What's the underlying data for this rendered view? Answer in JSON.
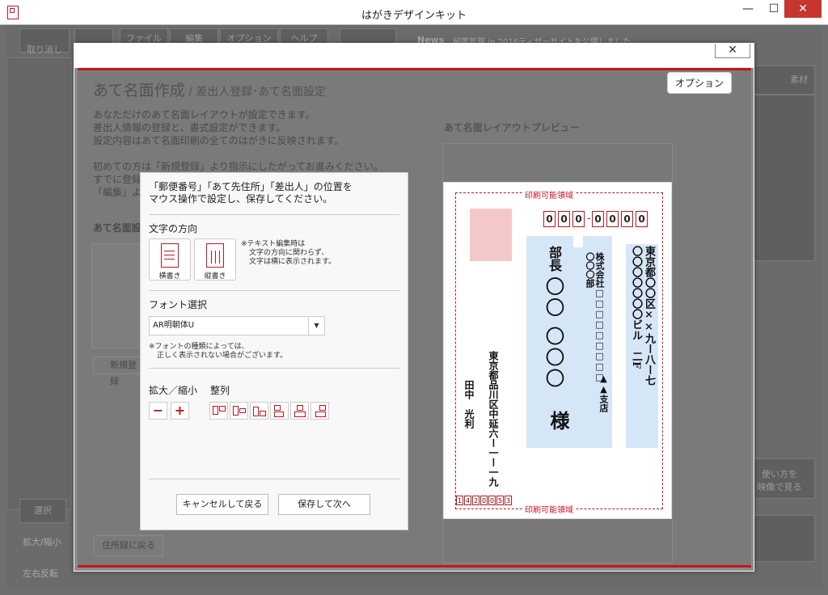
{
  "window": {
    "title": "はがきデザインキット",
    "minimize": "—",
    "maximize": "☐",
    "close": "✕"
  },
  "bg": {
    "undo": "取り消し",
    "menu": [
      "ファイル",
      "編集",
      "オプション",
      "ヘルプ"
    ],
    "news_label": "News",
    "news_text": "秘匿年賀.jp 2016ティザーサイトを公開しました。",
    "material": "素材",
    "select_tool": "選択",
    "zoom": "拡大/縮小",
    "flip": "左右反転",
    "how_to_1": "使い方を",
    "how_to_2": "映像で見る"
  },
  "modal": {
    "close": "✕",
    "heading": "あて名面作成",
    "subheading": " / 差出人登録･あて名面設定",
    "option_button": "オプション",
    "desc": [
      "あなただけのあて名面レイアウトが設定できます。",
      "差出人情報の登録と、書式設定ができます。",
      "設定内容はあて名面印刷の全てのはがきに反映されます。"
    ],
    "desc2": [
      "初めての方は「新規登録」より指示にしたがってお進みください。",
      "すでに登録",
      "「編集」より"
    ],
    "atena_label": "あて名面設",
    "new_reg": "新規登録",
    "back_btn": "住所録に戻る",
    "preview_label": "あて名面レイアウトプレビュー"
  },
  "postcard": {
    "print_area": "印刷可能領域",
    "zip": [
      "0",
      "0",
      "0",
      "0",
      "0",
      "0",
      "0"
    ],
    "zip_dash": "-",
    "sender_zip": [
      "1",
      "4",
      "2",
      "0",
      "0",
      "5",
      "3"
    ],
    "addr1": "東京都〇〇区××九ー八ー七",
    "addr2": "〇〇〇〇〇〇〇ビル　二F",
    "company": "株式会社□□□□□□□□□",
    "dept": "〇〇〇部",
    "branch": "▲▲支店",
    "title_role": "部長",
    "name": "〇〇 〇〇〇",
    "honorific": "様",
    "sender_addr": "東京都品川区中延六ー一ー一九",
    "sender_name": "田中　光利"
  },
  "panel": {
    "intro1": "「郵便番号」「あて先住所」「差出人」の位置を",
    "intro2": "マウス操作で設定し、保存してください。",
    "dir_label": "文字の方向",
    "horizontal": "横書き",
    "vertical": "縦書き",
    "note1": "※テキスト編集時は",
    "note2": "文字の方向に関わらず、",
    "note3": "文字は横に表示されます。",
    "font_label": "フォント選択",
    "font_value": "AR明朝体U",
    "font_note1": "※フォントの種類によっては、",
    "font_note2": "正しく表示されない場合がございます。",
    "zoom_label": "拡大／縮小",
    "align_label": "整列",
    "minus": "−",
    "plus": "+",
    "cancel": "キャンセルして戻る",
    "save": "保存して次へ"
  }
}
